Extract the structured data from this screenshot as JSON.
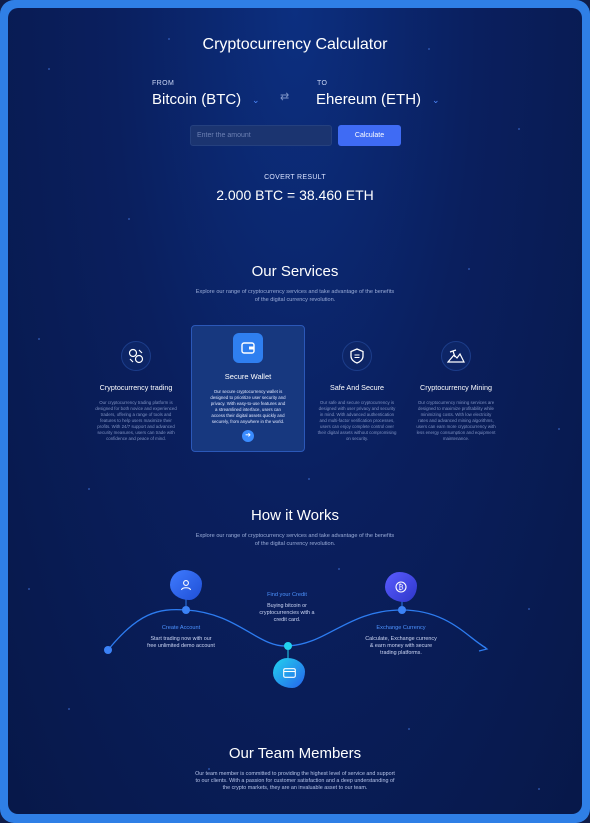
{
  "calculator": {
    "title": "Cryptocurrency Calculator",
    "from_label": "FROM",
    "from_value": "Bitcoin (BTC)",
    "to_label": "TO",
    "to_value": "Ehereum (ETH)",
    "amount_placeholder": "Enter the amount",
    "calculate_label": "Calculate",
    "result_label": "COVERT RESULT",
    "result_value": "2.000 BTC = 38.460 ETH"
  },
  "services": {
    "title": "Our Services",
    "subtitle_line1": "Explore our range of cryptocurrency services and take advantage of the benefits",
    "subtitle_line2": "of the digital currency revolution.",
    "items": [
      {
        "icon": "exchange-coins-icon",
        "title": "Cryptocurrency trading",
        "lines": [
          "Our cryptocurrency trading platform is",
          "designed for both novice and experienced",
          "traders, offering a range of tools and",
          "features to help users maximize their",
          "profits. With 24/7 support and advanced",
          "security measures, users can trade with",
          "confidence and peace of mind."
        ]
      },
      {
        "icon": "wallet-icon",
        "title": "Secure Wallet",
        "lines": [
          "Our secure cryptocurrency wallet is",
          "designed to prioritize user security and",
          "privacy. With easy-to-use features and",
          "a streamlined interface, users can",
          "access their digital assets quickly and",
          "securely, from anywhere in the world."
        ]
      },
      {
        "icon": "shield-icon",
        "title": "Safe And Secure",
        "lines": [
          "Our safe and secure cryptocurrency is",
          "designed with user privacy and security",
          "in mind. With advanced authentication",
          "and multi-factor verification processes,",
          "users can enjoy complete control over",
          "their digital assets without compromising",
          "on security."
        ]
      },
      {
        "icon": "mining-icon",
        "title": "Cryptocurrency Mining",
        "lines": [
          "Our cryptocurrency mining services are",
          "designed to maximize profitability while",
          "minimizing costs. With low electricity",
          "rates and advanced mining algorithms,",
          "users can earn more cryptocurrency with",
          "less energy consumption and equipment",
          "maintenance."
        ]
      }
    ]
  },
  "how": {
    "title": "How it Works",
    "subtitle_line1": "Explore our range of cryptocurrency services and take advantage of the benefits",
    "subtitle_line2": "of the digital currency revolution.",
    "steps": [
      {
        "title": "Create Account",
        "lines": [
          "Start trading now with our",
          "free unlimited demo account"
        ]
      },
      {
        "title": "Find your Credit",
        "lines": [
          "Buying bitcoin or",
          "cryptocurrencies with a",
          "credit card."
        ]
      },
      {
        "title": "Exchange Currency",
        "lines": [
          "Calculate, Exchange currency",
          "& earn money with secure",
          "trading platforms."
        ]
      }
    ]
  },
  "team": {
    "title": "Our Team Members",
    "lines": [
      "Our team member is committed to providing the highest level of service and support",
      "to our clients. With a passion for customer satisfaction and a deep understanding of",
      "the crypto markets, they are an invaluable asset to our team."
    ]
  },
  "colors": {
    "accent": "#3f6bf4",
    "background": "#0a1f5e",
    "frame": "#2f7fe6",
    "step_title": "#4d93ff"
  }
}
